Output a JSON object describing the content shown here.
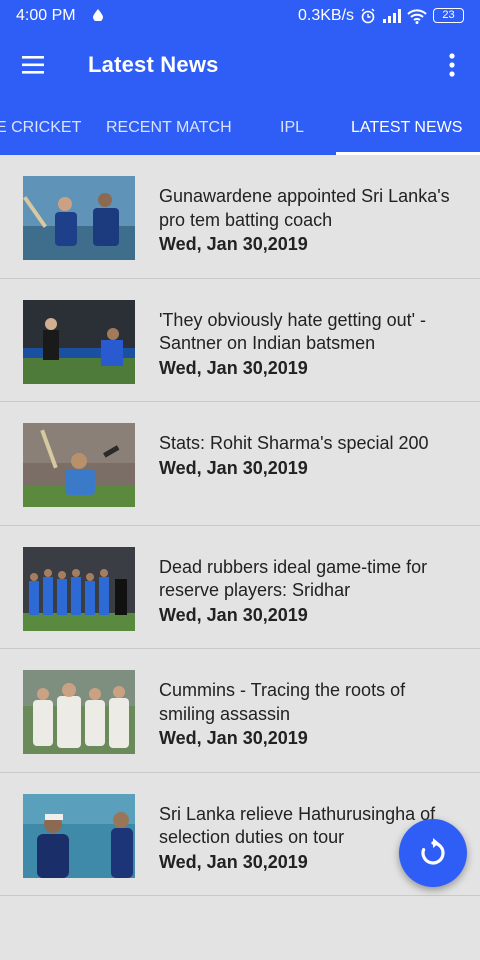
{
  "status_bar": {
    "time": "4:00 PM",
    "speed": "0.3KB/s",
    "battery": "23"
  },
  "app_bar": {
    "title": "Latest News"
  },
  "tabs": [
    {
      "label": "E CRICKET",
      "active": false
    },
    {
      "label": "RECENT MATCH",
      "active": false
    },
    {
      "label": "IPL",
      "active": false
    },
    {
      "label": "LATEST NEWS",
      "active": true
    }
  ],
  "news": [
    {
      "title": "Gunawardene appointed Sri Lanka's pro tem batting coach",
      "date": "Wed, Jan 30,2019"
    },
    {
      "title": "'They obviously hate getting out' - Santner on Indian batsmen",
      "date": "Wed, Jan 30,2019"
    },
    {
      "title": "Stats: Rohit Sharma's special 200",
      "date": "Wed, Jan 30,2019"
    },
    {
      "title": "Dead rubbers ideal game-time for reserve players: Sridhar",
      "date": "Wed, Jan 30,2019"
    },
    {
      "title": "Cummins - Tracing the roots of smiling assassin",
      "date": "Wed, Jan 30,2019"
    },
    {
      "title": "Sri Lanka relieve Hathurusingha of selection duties on tour",
      "date": "Wed, Jan 30,2019"
    }
  ],
  "colors": {
    "primary": "#2f5ef6",
    "background": "#e3e3e3"
  },
  "icons": {
    "menu": "hamburger-menu-icon",
    "overflow": "more-vert-icon",
    "fab": "refresh-icon"
  }
}
